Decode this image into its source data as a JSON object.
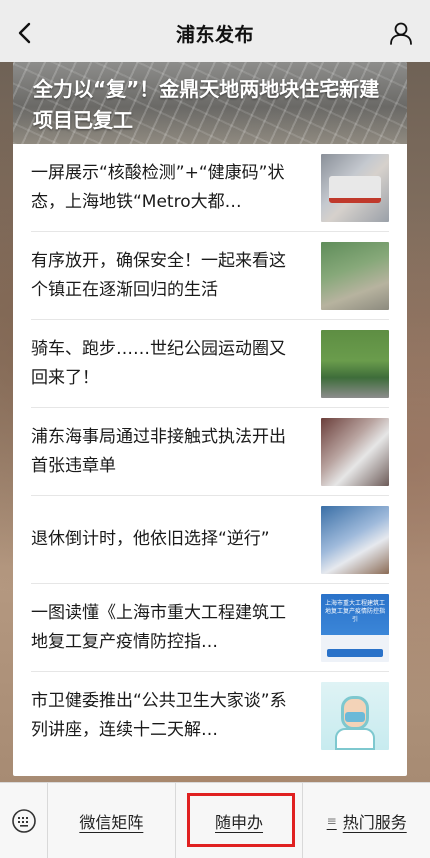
{
  "nav": {
    "title": "浦东发布",
    "back_icon": "chevron-left-icon",
    "profile_icon": "person-icon"
  },
  "hero": {
    "title": "全力以“复”！金鼎天地两地块住宅新建项目已复工"
  },
  "articles": [
    {
      "title": "一屏展示“核酸检测”+“健康码”状态，上海地铁“Metro大都…"
    },
    {
      "title": "有序放开，确保安全！一起来看这个镇正在逐渐回归的生活"
    },
    {
      "title": "骑车、跑步……世纪公园运动圈又回来了！"
    },
    {
      "title": "浦东海事局通过非接触式执法开出首张违章单"
    },
    {
      "title": "退休倒计时，他依旧选择“逆行”"
    },
    {
      "title": "一图读懂《上海市重大工程建筑工地复工复产疫情防控指…"
    },
    {
      "title": "市卫健委推出“公共卫生大家谈”系列讲座，连续十二天解…"
    }
  ],
  "thumb6_text": "上海市重大工程建筑工地复工复产疫情防控指引",
  "bottom_menu": {
    "keyboard_icon": "keyboard-icon",
    "items": [
      {
        "label": "微信矩阵"
      },
      {
        "label": "随申办"
      },
      {
        "label": "热门服务",
        "icon": "menu-dots-icon"
      }
    ]
  },
  "colors": {
    "highlight_border": "#e02020",
    "nav_bg": "#ededed"
  }
}
